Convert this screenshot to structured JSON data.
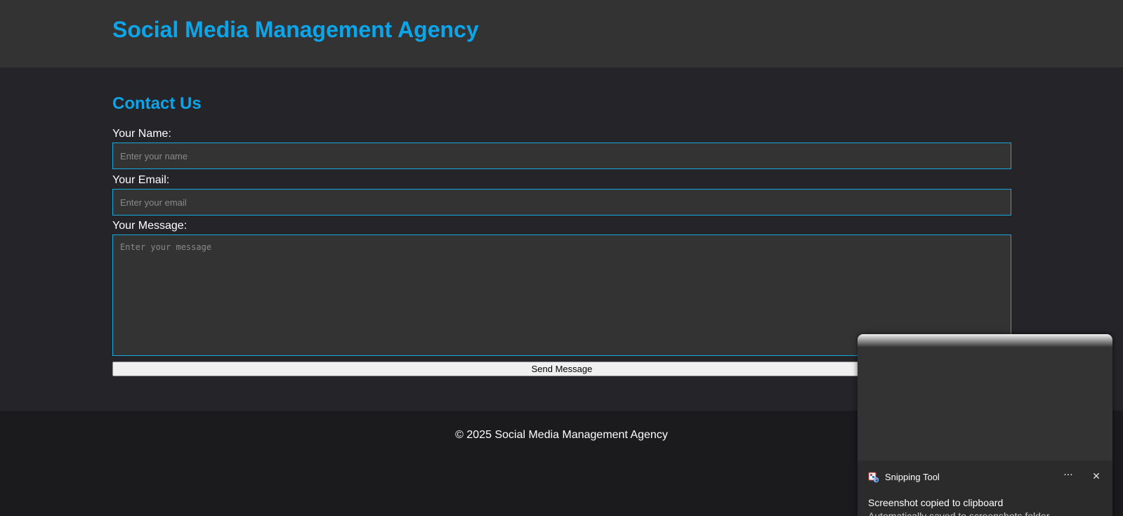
{
  "header": {
    "title": "Social Media Management Agency"
  },
  "contact": {
    "title": "Contact Us",
    "name_label": "Your Name:",
    "name_placeholder": "Enter your name",
    "name_value": "",
    "email_label": "Your Email:",
    "email_placeholder": "Enter your email",
    "email_value": "",
    "message_label": "Your Message:",
    "message_placeholder": "Enter your message",
    "message_value": "",
    "submit_label": "Send Message"
  },
  "footer": {
    "text": "© 2025 Social Media Management Agency"
  },
  "toast": {
    "app_name": "Snipping Tool",
    "more_icon": "ellipsis-icon",
    "close_icon": "close-icon",
    "message": "Screenshot copied to clipboard",
    "submessage": "Automatically saved to screenshots folder"
  },
  "colors": {
    "accent": "#0ba5e9",
    "header_bg": "#333333",
    "main_bg": "#242429",
    "footer_bg": "#1b1b1e",
    "input_bg": "#333333",
    "input_border": "#18a9dc"
  }
}
